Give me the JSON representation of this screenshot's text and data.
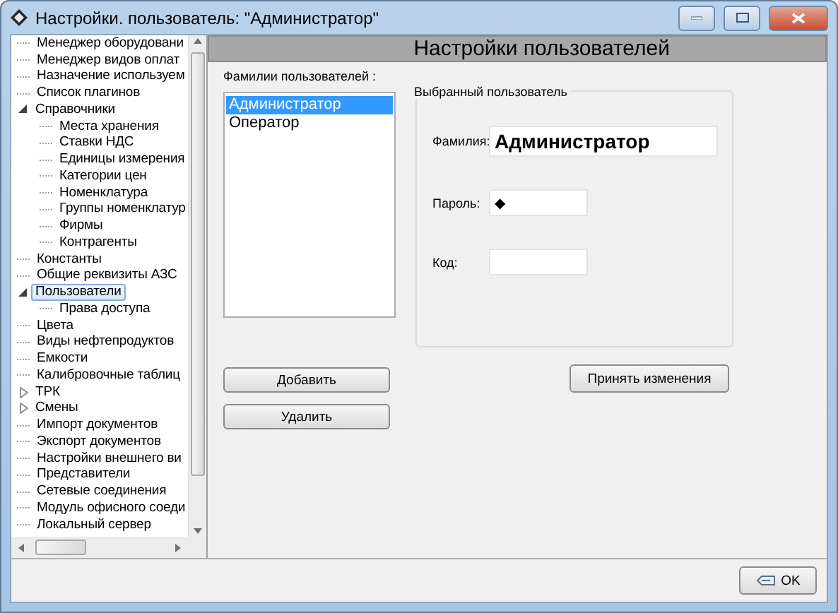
{
  "window": {
    "title": "Настройки. пользователь: \"Администратор\""
  },
  "tree": [
    {
      "label": "Менеджер оборудовани",
      "selected": false
    },
    {
      "label": "Менеджер видов оплат",
      "selected": false
    },
    {
      "label": "Назначение используем",
      "selected": false
    },
    {
      "label": "Список плагинов",
      "selected": false
    },
    {
      "label": "Справочники",
      "selected": false,
      "expanded": true,
      "children": [
        {
          "label": "Места хранения",
          "selected": false
        },
        {
          "label": "Ставки НДС",
          "selected": false
        },
        {
          "label": "Единицы измерения",
          "selected": false
        },
        {
          "label": "Категории цен",
          "selected": false
        },
        {
          "label": "Номенклатура",
          "selected": false
        },
        {
          "label": "Группы номенклатур",
          "selected": false
        },
        {
          "label": "Фирмы",
          "selected": false
        },
        {
          "label": "Контрагенты",
          "selected": false
        }
      ]
    },
    {
      "label": "Константы",
      "selected": false
    },
    {
      "label": "Общие реквизиты АЗС",
      "selected": false
    },
    {
      "label": "Пользователи",
      "selected": true,
      "expanded": true,
      "children": [
        {
          "label": "Права доступа",
          "selected": false
        }
      ]
    },
    {
      "label": "Цвета",
      "selected": false
    },
    {
      "label": "Виды нефтепродуктов",
      "selected": false
    },
    {
      "label": "Емкости",
      "selected": false
    },
    {
      "label": "Калибровочные таблиц",
      "selected": false
    },
    {
      "label": "ТРК",
      "selected": false,
      "expanded": false
    },
    {
      "label": "Смены",
      "selected": false,
      "expanded": false
    },
    {
      "label": "Импорт документов",
      "selected": false
    },
    {
      "label": "Экспорт документов",
      "selected": false
    },
    {
      "label": "Настройки внешнего ви",
      "selected": false
    },
    {
      "label": "Представители",
      "selected": false
    },
    {
      "label": "Сетевые соединения",
      "selected": false
    },
    {
      "label": "Модуль офисного соеди",
      "selected": false
    },
    {
      "label": "Локальный сервер",
      "selected": false
    }
  ],
  "header": "Настройки пользователей",
  "users_label": "Фамилии пользователей :",
  "users": [
    {
      "name": "Администратор",
      "selected": true
    },
    {
      "name": "Оператор",
      "selected": false
    }
  ],
  "group_title": "Выбранный пользователь",
  "fields": [
    {
      "label": "Фамилия:",
      "value": "Администратор",
      "kind": "bold"
    },
    {
      "label": "Пароль:",
      "value": "◆",
      "kind": "short"
    },
    {
      "label": "Код:",
      "kind": "short"
    }
  ],
  "buttons": [
    "Добавить",
    "Удалить"
  ],
  "apply_button": "Принять изменения",
  "ok_button": "OK"
}
